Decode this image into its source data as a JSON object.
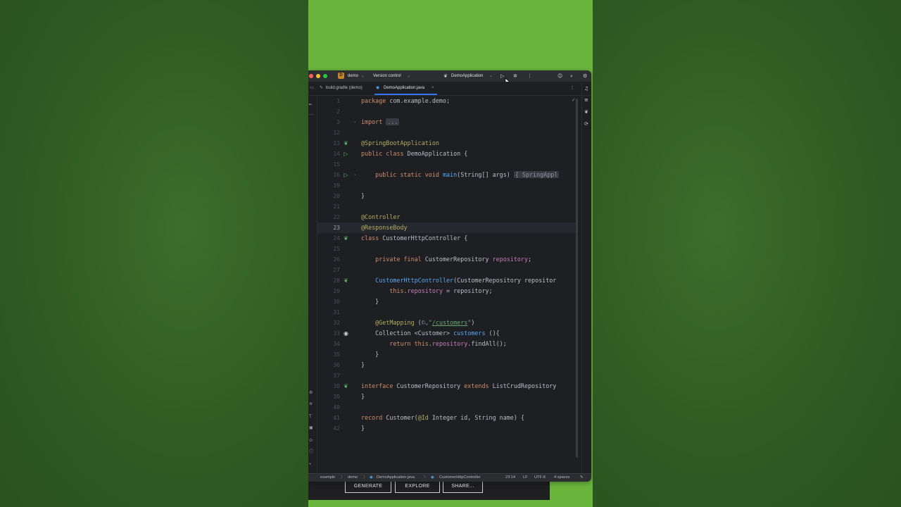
{
  "titlebar": {
    "project_initial": "D",
    "project_name": "demo",
    "vcs_label": "Version control",
    "run_config": "DemoApplication"
  },
  "tabs": [
    {
      "label": "build.gradle (demo)",
      "active": false
    },
    {
      "label": "DemoApplication.java",
      "active": true
    }
  ],
  "code_lines": [
    {
      "num": "1"
    },
    {
      "num": "2"
    },
    {
      "num": "3"
    },
    {
      "num": "12"
    },
    {
      "num": "13"
    },
    {
      "num": "14"
    },
    {
      "num": "15"
    },
    {
      "num": "16"
    },
    {
      "num": "19"
    },
    {
      "num": "20"
    },
    {
      "num": "21"
    },
    {
      "num": "22"
    },
    {
      "num": "23"
    },
    {
      "num": "24"
    },
    {
      "num": "25"
    },
    {
      "num": "26"
    },
    {
      "num": "27"
    },
    {
      "num": "28"
    },
    {
      "num": "29"
    },
    {
      "num": "30"
    },
    {
      "num": "31"
    },
    {
      "num": "32"
    },
    {
      "num": "33"
    },
    {
      "num": "34"
    },
    {
      "num": "35"
    },
    {
      "num": "36"
    },
    {
      "num": "37"
    },
    {
      "num": "38"
    },
    {
      "num": "39"
    },
    {
      "num": "40"
    },
    {
      "num": "41"
    },
    {
      "num": "42"
    }
  ],
  "code": {
    "l1_kw": "package",
    "l1_rest": " com.example.demo;",
    "l3_kw": "import",
    "l3_fold": "...",
    "l13": "@SpringBootApplication",
    "l14_kw": "public class",
    "l14_rest": " DemoApplication {",
    "l16_kw": "    public static void",
    "l16_fn": " main",
    "l16_rest": "(String[] args)",
    "l16_fold": "{ SpringAppl",
    "l20": "}",
    "l22": "@Controller",
    "l23": "@ResponseBody",
    "l24_kw": "class",
    "l24_rest": " CustomerHttpController {",
    "l26_kw": "    private final",
    "l26_rest": " CustomerRepository ",
    "l26_fld": "repository",
    "l26_end": ";",
    "l28_fn": "    CustomerHttpController",
    "l28_rest": "(CustomerRepository repositor",
    "l29_kw": "        this",
    "l29_dot": ".",
    "l29_fld": "repository",
    "l29_rest": " = repository;",
    "l30": "    }",
    "l32_ann": "    @GetMapping",
    "l32_open": " (",
    "l32_icon": "©⌄",
    "l32_q1": "\"",
    "l32_str": "/customers",
    "l32_q2": "\"",
    "l32_close": ")",
    "l33_rest": "    Collection <Customer> ",
    "l33_fn": "customers",
    "l33_end": " (){",
    "l34_kw": "        return this",
    "l34_dot": ".",
    "l34_fld": "repository",
    "l34_rest": ".findAll();",
    "l35": "    }",
    "l36": "}",
    "l38_kw": "interface",
    "l38_rest": " CustomerRepository ",
    "l38_kw2": "extends",
    "l38_rest2": " ListCrudRepository",
    "l39": "}",
    "l41_kw": "record",
    "l41_rest": " Customer(",
    "l41_ann": "@Id",
    "l41_rest2": " Integer id, String name) {",
    "l42": "}"
  },
  "statusbar": {
    "breadcrumb_1": "example",
    "sep": "〉",
    "breadcrumb_2": "demo",
    "breadcrumb_3": "DemoApplication.java",
    "breadcrumb_4": "CustomerHttpController",
    "position": "23:14",
    "line_sep": "LF",
    "encoding": "UTF-8",
    "indent": "4 spaces"
  },
  "bottom_buttons": {
    "generate": "GENERATE",
    "explore": "EXPLORE",
    "share": "SHARE..."
  },
  "colors": {
    "accent": "#3574f0",
    "page_green": "#6ab63d",
    "editor_bg": "#1e1f22"
  }
}
